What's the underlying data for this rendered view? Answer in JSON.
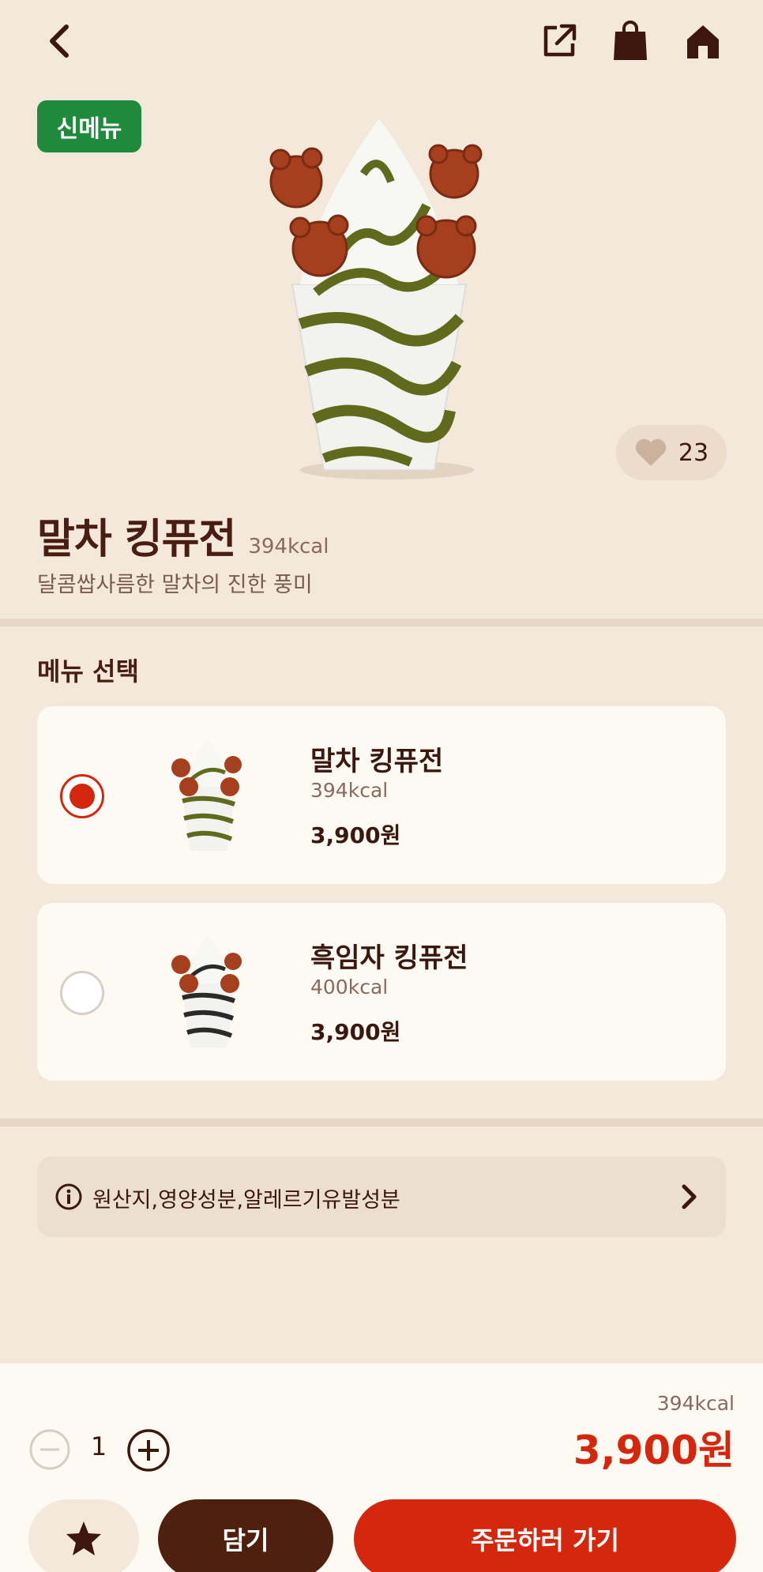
{
  "header": {
    "back_icon": "chevron-left-icon",
    "share_icon": "share-icon",
    "bag_icon": "shopping-bag-icon",
    "home_icon": "home-icon"
  },
  "product": {
    "badge": "신메뉴",
    "likes": "23",
    "name": "말차 킹퓨전",
    "kcal": "394kcal",
    "description": "달콤쌉사름한 말차의 진한 풍미"
  },
  "menu_select": {
    "title": "메뉴 선택",
    "options": [
      {
        "name": "말차 킹퓨전",
        "kcal": "394kcal",
        "price": "3,900원",
        "selected": true
      },
      {
        "name": "흑임자 킹퓨전",
        "kcal": "400kcal",
        "price": "3,900원",
        "selected": false
      }
    ]
  },
  "info": {
    "label": "원산지,영양성분,알레르기유발성분"
  },
  "order_bar": {
    "quantity": "1",
    "total_kcal": "394kcal",
    "total_price": "3,900원",
    "cart_label": "담기",
    "order_label": "주문하러 가기"
  },
  "colors": {
    "background": "#f3e8da",
    "brand_red": "#d5270e",
    "brand_brown": "#50200f",
    "new_badge": "#1f8a3c"
  }
}
